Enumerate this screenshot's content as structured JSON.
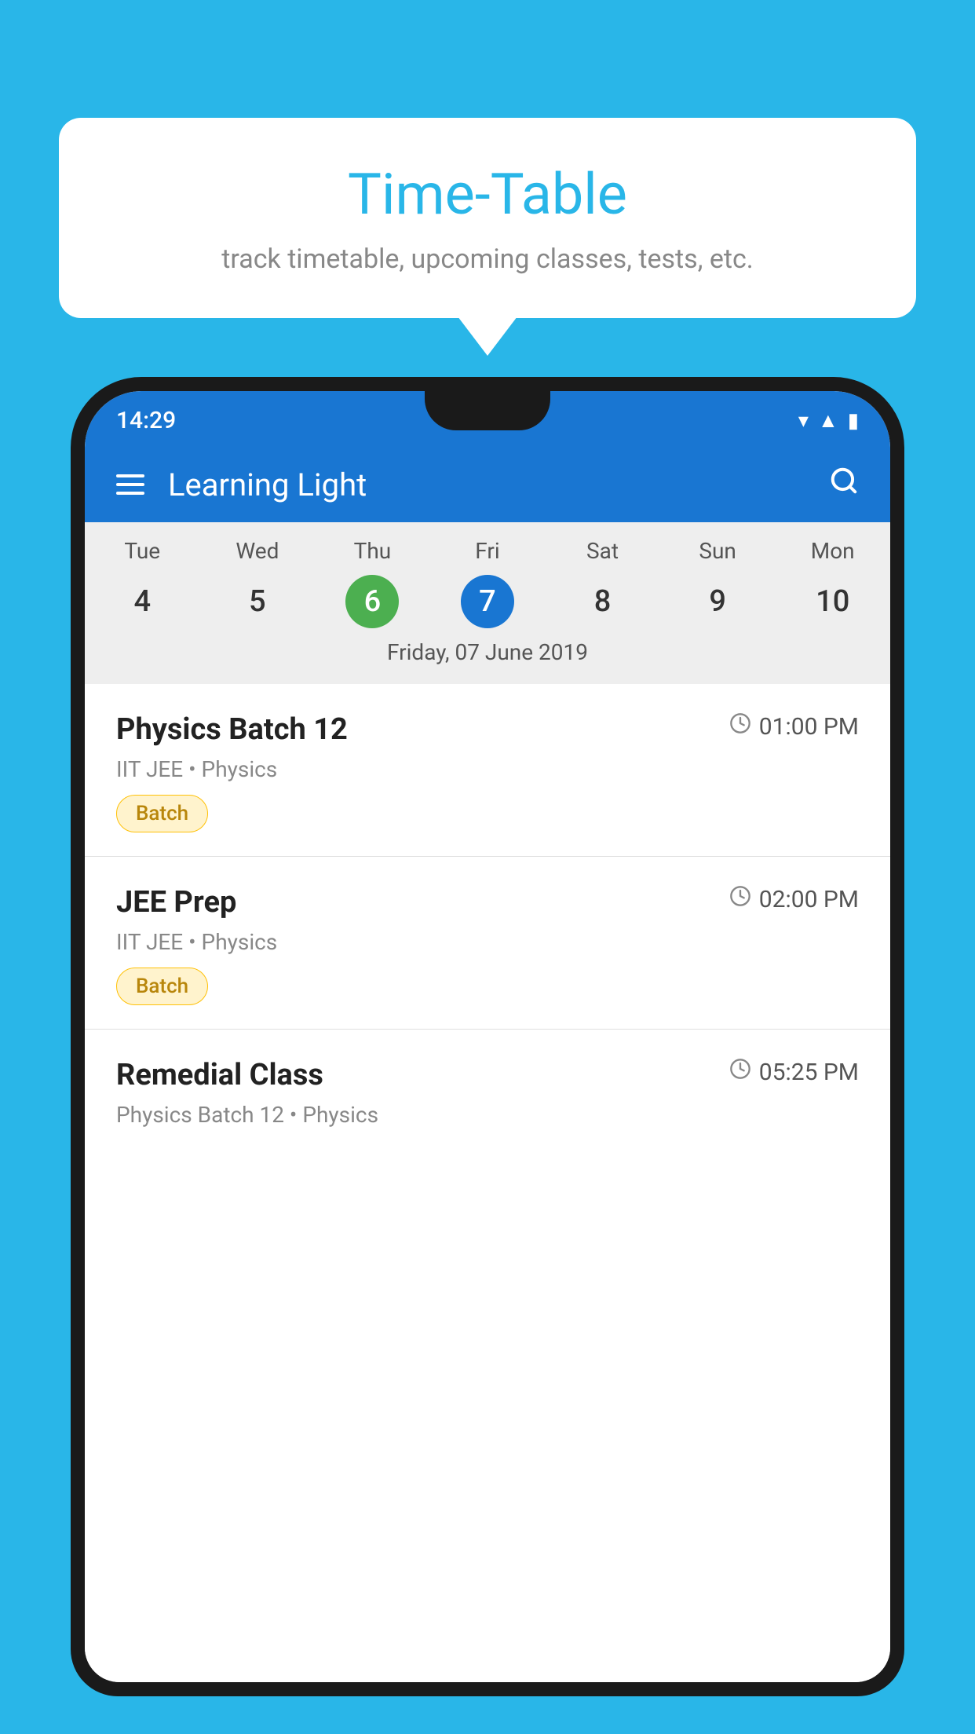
{
  "background": {
    "color": "#29b6e8"
  },
  "speech_bubble": {
    "title": "Time-Table",
    "subtitle": "track timetable, upcoming classes, tests, etc."
  },
  "status_bar": {
    "time": "14:29"
  },
  "app_bar": {
    "title": "Learning Light"
  },
  "calendar": {
    "days": [
      "Tue",
      "Wed",
      "Thu",
      "Fri",
      "Sat",
      "Sun",
      "Mon"
    ],
    "numbers": [
      "4",
      "5",
      "6",
      "7",
      "8",
      "9",
      "10"
    ],
    "today_index": 2,
    "selected_index": 3,
    "selected_date_label": "Friday, 07 June 2019"
  },
  "schedule": [
    {
      "title": "Physics Batch 12",
      "time": "01:00 PM",
      "subtitle": "IIT JEE • Physics",
      "badge": "Batch"
    },
    {
      "title": "JEE Prep",
      "time": "02:00 PM",
      "subtitle": "IIT JEE • Physics",
      "badge": "Batch"
    },
    {
      "title": "Remedial Class",
      "time": "05:25 PM",
      "subtitle": "Physics Batch 12 • Physics",
      "badge": null
    }
  ]
}
